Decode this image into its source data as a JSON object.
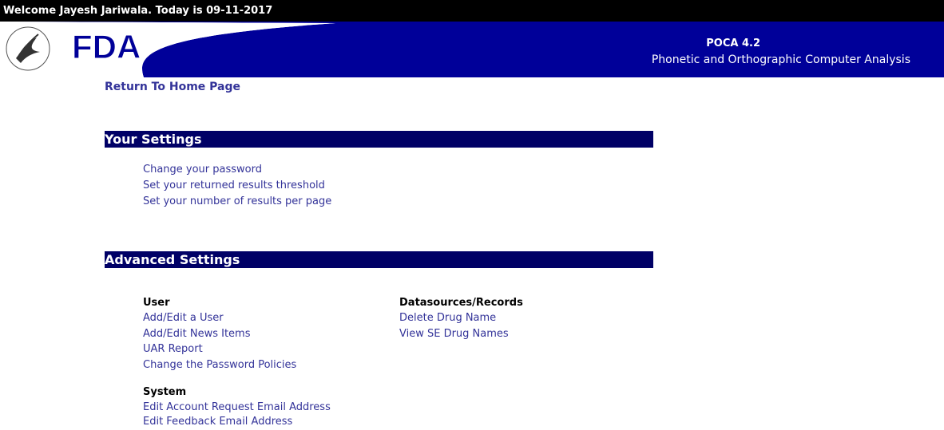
{
  "welcome_text": "Welcome Jayesh Jariwala. Today is 09-11-2017",
  "header": {
    "logo_text": "FDA",
    "app_name": "POCA 4.2",
    "app_subtitle": "Phonetic and Orthographic Computer Analysis",
    "banner_color": "#000099"
  },
  "home_link": "Return To Home Page",
  "your_settings": {
    "title": "Your Settings",
    "links": [
      "Change your password",
      "Set your returned results threshold",
      "Set your number of results per page"
    ]
  },
  "advanced_settings": {
    "title": "Advanced Settings",
    "user": {
      "heading": "User",
      "links": [
        "Add/Edit a User",
        "Add/Edit News Items",
        "UAR Report",
        "Change the Password Policies"
      ]
    },
    "datasources": {
      "heading": "Datasources/Records",
      "links": [
        "Delete Drug Name",
        "View SE Drug Names"
      ]
    },
    "system": {
      "heading": "System",
      "links": [
        "Edit Account Request Email Address",
        "Edit Feedback Email Address"
      ]
    }
  }
}
